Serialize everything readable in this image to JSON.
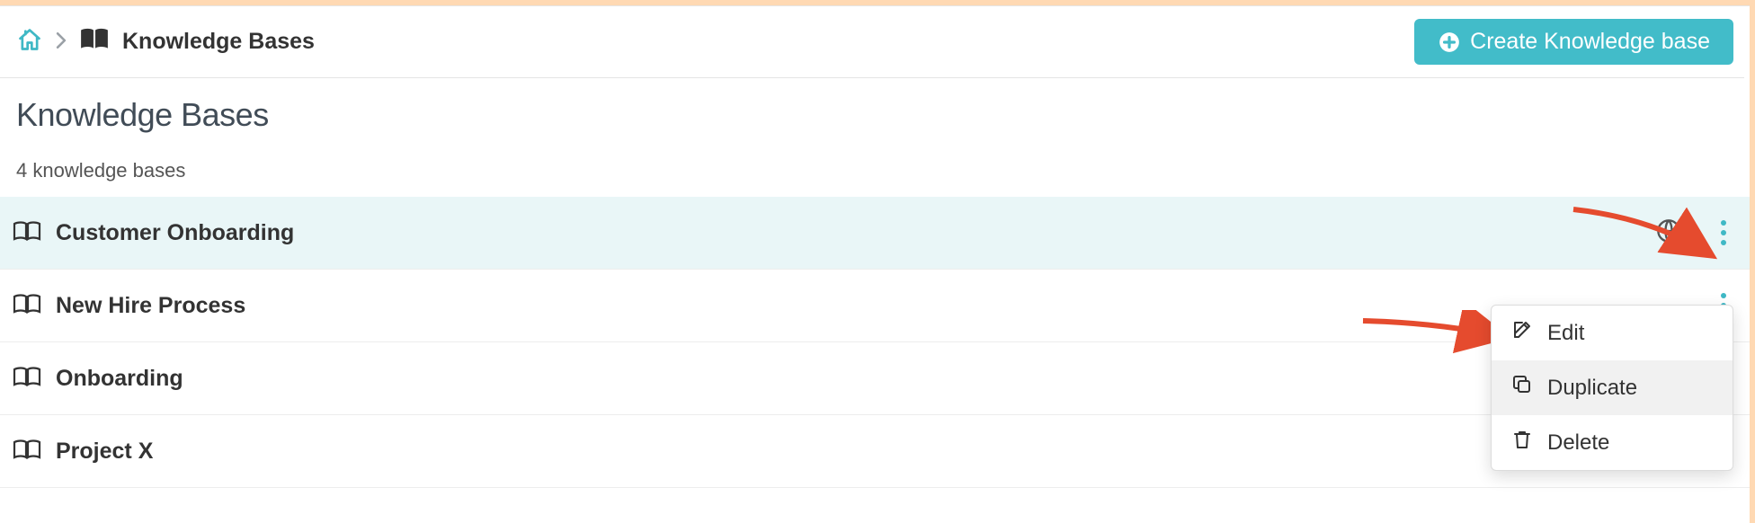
{
  "breadcrumb": {
    "current": "Knowledge Bases"
  },
  "create_button": "Create Knowledge base",
  "page": {
    "title": "Knowledge Bases",
    "count_text": "4 knowledge bases"
  },
  "rows": [
    {
      "name": "Customer Onboarding",
      "public": true,
      "highlight": true,
      "menu_open": true
    },
    {
      "name": "New Hire Process",
      "public": false,
      "highlight": false,
      "menu_open": false
    },
    {
      "name": "Onboarding",
      "public": false,
      "highlight": false,
      "menu_open": false
    },
    {
      "name": "Project X",
      "public": true,
      "highlight": false,
      "menu_open": false
    }
  ],
  "menu": {
    "edit": "Edit",
    "duplicate": "Duplicate",
    "delete": "Delete"
  }
}
